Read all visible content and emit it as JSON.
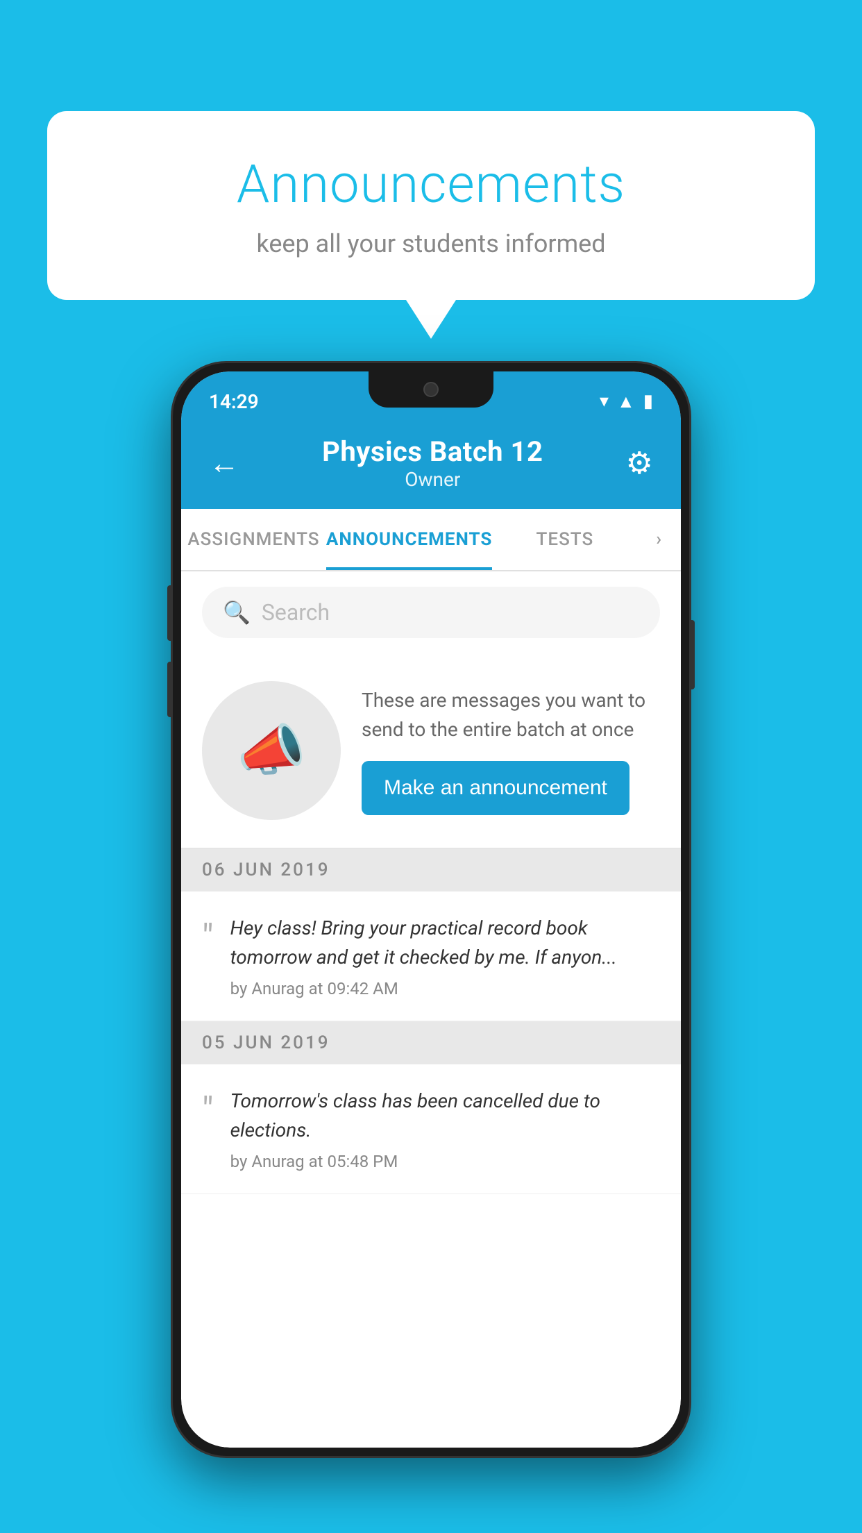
{
  "background_color": "#1bbde8",
  "speech_bubble": {
    "title": "Announcements",
    "subtitle": "keep all your students informed"
  },
  "phone": {
    "status_bar": {
      "time": "14:29"
    },
    "header": {
      "title": "Physics Batch 12",
      "subtitle": "Owner",
      "back_label": "←",
      "gear_label": "⚙"
    },
    "tabs": [
      {
        "label": "ASSIGNMENTS",
        "active": false
      },
      {
        "label": "ANNOUNCEMENTS",
        "active": true
      },
      {
        "label": "TESTS",
        "active": false
      },
      {
        "label": "›",
        "active": false
      }
    ],
    "search": {
      "placeholder": "Search"
    },
    "promo": {
      "description": "These are messages you want to send to the entire batch at once",
      "button_label": "Make an announcement"
    },
    "announcements": [
      {
        "date": "06  JUN  2019",
        "items": [
          {
            "text": "Hey class! Bring your practical record book tomorrow and get it checked by me. If anyon...",
            "meta": "by Anurag at 09:42 AM"
          }
        ]
      },
      {
        "date": "05  JUN  2019",
        "items": [
          {
            "text": "Tomorrow's class has been cancelled due to elections.",
            "meta": "by Anurag at 05:48 PM"
          }
        ]
      }
    ]
  }
}
